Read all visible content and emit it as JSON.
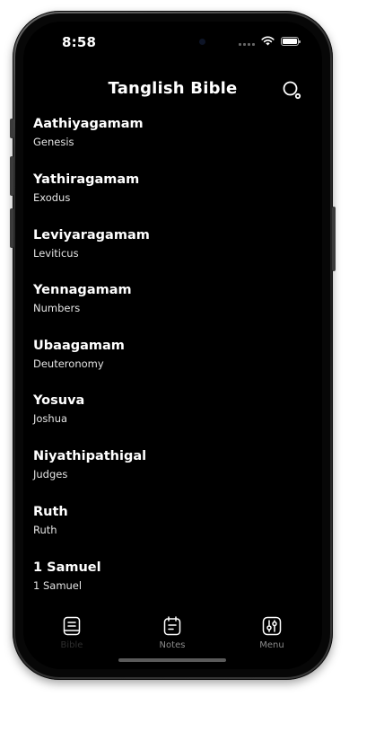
{
  "status_bar": {
    "time": "8:58",
    "icons": [
      "cellular-icon",
      "wifi-icon",
      "battery-icon"
    ]
  },
  "header": {
    "title": "Tanglish Bible",
    "search_icon": "search-icon"
  },
  "books": [
    {
      "name": "Aathiyagamam",
      "english": "Genesis"
    },
    {
      "name": "Yathiragamam",
      "english": "Exodus"
    },
    {
      "name": "Leviyaragamam",
      "english": "Leviticus"
    },
    {
      "name": "Yennagamam",
      "english": "Numbers"
    },
    {
      "name": "Ubaagamam",
      "english": "Deuteronomy"
    },
    {
      "name": "Yosuva",
      "english": "Joshua"
    },
    {
      "name": "Niyathipathigal",
      "english": "Judges"
    },
    {
      "name": "Ruth",
      "english": "Ruth"
    },
    {
      "name": "1 Samuel",
      "english": "1 Samuel"
    }
  ],
  "tabs": [
    {
      "label": "Bible",
      "icon": "book-icon",
      "active": true
    },
    {
      "label": "Notes",
      "icon": "notes-icon",
      "active": false
    },
    {
      "label": "Menu",
      "icon": "sliders-icon",
      "active": false
    }
  ],
  "colors": {
    "background": "#000000",
    "text_primary": "#ffffff",
    "tab_inactive_label": "#8a8a8a"
  }
}
